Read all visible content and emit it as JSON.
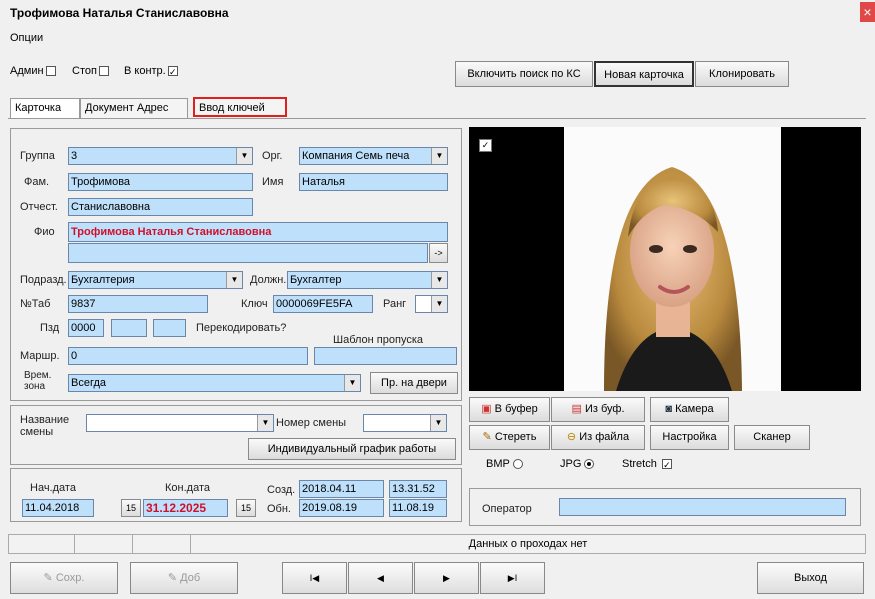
{
  "window": {
    "title": "Трофимова Наталья Станиславовна",
    "close_glyph": "×"
  },
  "menu": {
    "options": "Опции"
  },
  "toolbar": {
    "admin_label": "Админ",
    "admin_checked": false,
    "stop_label": "Стоп",
    "stop_checked": false,
    "incontrol_label": "В контр.",
    "incontrol_checked": true,
    "search_ks": "Включить поиск по КС",
    "new_card": "Новая карточка",
    "clone": "Клонировать"
  },
  "tabs": [
    "Карточка",
    "Документ Адрес",
    "Ввод ключей"
  ],
  "form": {
    "group_label": "Группа",
    "group_value": "3",
    "org_label": "Орг.",
    "org_value": "Компания Семь печа",
    "last_label": "Фам.",
    "last_value": "Трофимова",
    "first_label": "Имя",
    "first_value": "Наталья",
    "middle_label": "Отчест.",
    "middle_value": "Станиславовна",
    "fio_label": "Фио",
    "fio_value": "Трофимова Наталья Станиславовна",
    "arrow_glyph": "->",
    "dept_label": "Подразд.",
    "dept_value": "Бухгалтерия",
    "pos_label": "Должн.",
    "pos_value": "Бухгалтер",
    "tabnum_label": "№Таб",
    "tabnum_value": "9837",
    "key_label": "Ключ",
    "key_value": "0000069FE5FA",
    "rank_label": "Ранг",
    "rank_value": "",
    "ext_label": "Пзд",
    "ext_value": "0000",
    "ext_value2": "",
    "ext_value3": "",
    "recode_label": "Перекодировать?",
    "template_label": "Шаблон пропуска",
    "route_label": "Маршр.",
    "route_value": "0",
    "template_value": "",
    "zone_label": "Врем. зона",
    "zone_value": "Всегда",
    "door_rights": "Пр. на двери"
  },
  "shift": {
    "name_label": "Название смены",
    "name_value": "",
    "number_label": "Номер смены",
    "number_value": "",
    "schedule_button": "Индивидуальный график работы"
  },
  "dates": {
    "start_label": "Нач.дата",
    "start_value": "11.04.2018",
    "end_label": "Кон.дата",
    "end_value": "31.12.2025",
    "calendar_glyph": "15",
    "created_label": "Созд.",
    "created_date": "2018.04.11",
    "created_time": "13.31.52",
    "updated_label": "Обн.",
    "updated_date": "2019.08.19",
    "updated_time": "11.08.19"
  },
  "photo": {
    "checkbox_checked": true,
    "to_buffer": "В буфер",
    "from_buffer": "Из буф.",
    "camera": "Камера",
    "erase": "Стереть",
    "from_file": "Из файла",
    "settings": "Настройка",
    "scanner": "Сканер",
    "bmp_label": "BMP",
    "jpg_label": "JPG",
    "stretch_label": "Stretch",
    "format_selected": "JPG",
    "stretch_checked": true,
    "operator_label": "Оператор",
    "operator_value": ""
  },
  "status": {
    "message": "Данных о проходах нет"
  },
  "nav": {
    "save": "Сохр.",
    "add": "Доб",
    "first": "I◀",
    "prev": "◀",
    "next": "▶",
    "last": "▶I",
    "exit": "Выход"
  },
  "colors": {
    "field_blue": "#bfe0fb",
    "highlight_red": "#e0201c",
    "fio_red": "#d0102a"
  }
}
